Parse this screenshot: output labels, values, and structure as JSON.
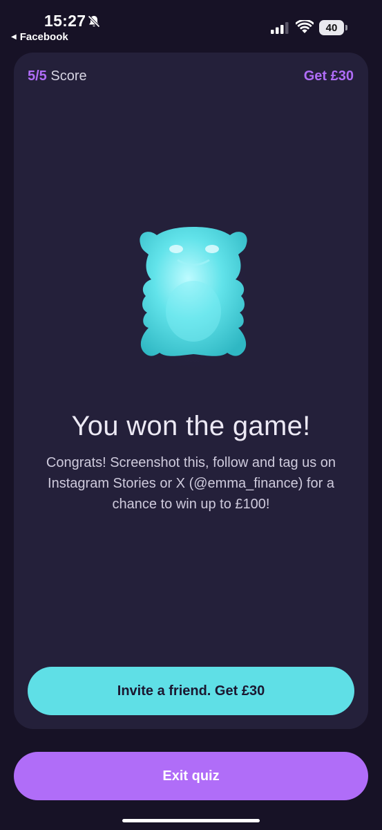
{
  "status_bar": {
    "time": "15:27",
    "back_app": "Facebook",
    "battery": "40"
  },
  "card": {
    "score_value": "5/5",
    "score_label": "Score",
    "get_link": "Get £30",
    "title": "You won the game!",
    "body": "Congrats! Screenshot this, follow and tag us on Instagram Stories or X (@emma_finance) for a chance to win up to £100!",
    "invite_label": "Invite a friend. Get £30"
  },
  "exit_label": "Exit quiz",
  "colors": {
    "background": "#171226",
    "card": "#24203a",
    "accent_purple": "#b06df8",
    "accent_cyan": "#5fdfe6"
  },
  "icons": {
    "mute": "bell-slash-icon",
    "signal": "cellular-signal-icon",
    "wifi": "wifi-icon",
    "illustration": "gummy-bear-icon"
  }
}
